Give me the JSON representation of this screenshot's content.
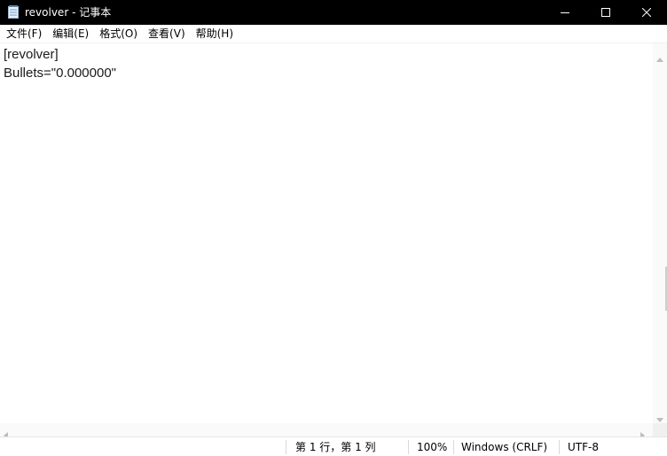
{
  "window": {
    "title": "revolver - 记事本",
    "app_icon": "notepad-icon"
  },
  "titlebar_controls": {
    "minimize_icon": "minimize-icon",
    "maximize_icon": "maximize-icon",
    "close_icon": "close-icon"
  },
  "menu": {
    "items": [
      {
        "label": "文件(F)"
      },
      {
        "label": "编辑(E)"
      },
      {
        "label": "格式(O)"
      },
      {
        "label": "查看(V)"
      },
      {
        "label": "帮助(H)"
      }
    ]
  },
  "editor": {
    "lines": [
      "[revolver]",
      "Bullets=\"0.000000\""
    ]
  },
  "statusbar": {
    "position": "第 1 行，第 1 列",
    "zoom": "100%",
    "line_ending": "Windows (CRLF)",
    "encoding": "UTF-8"
  },
  "colors": {
    "titlebar_bg": "#000000",
    "titlebar_fg": "#ffffff",
    "editor_bg": "#ffffff"
  }
}
